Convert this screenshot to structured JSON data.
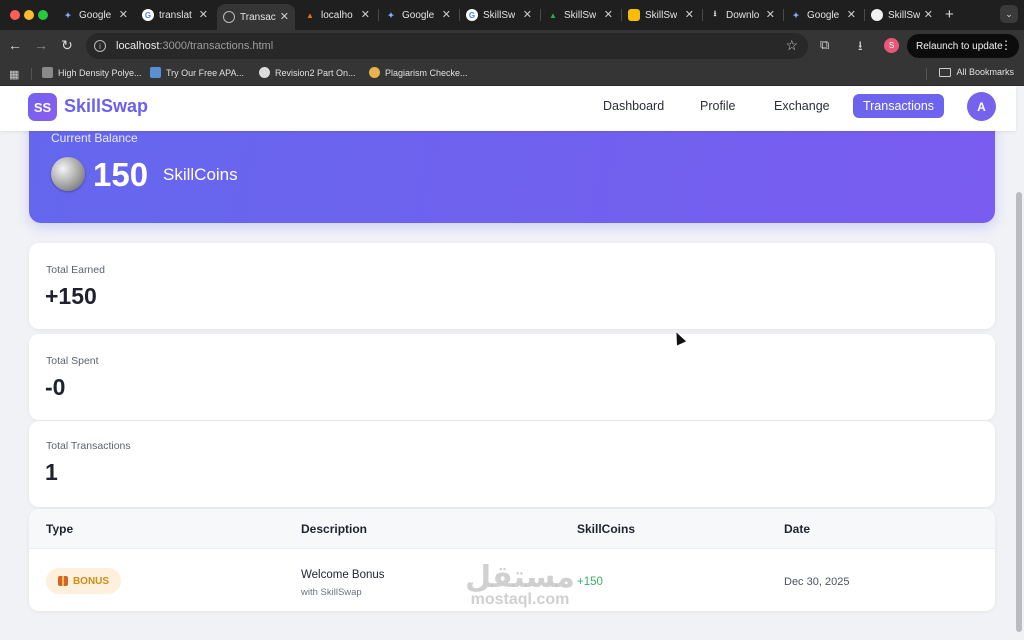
{
  "browser": {
    "tabs": [
      {
        "title": "Google",
        "icon": "gemini-icon",
        "color": "#8ab4f8"
      },
      {
        "title": "translat",
        "icon": "google-icon",
        "color": "#4285f4"
      },
      {
        "title": "Transac",
        "icon": "globe-icon",
        "color": "#9aa0a6",
        "active": true
      },
      {
        "title": "localho",
        "icon": "sails-icon",
        "color": "#e8731a"
      },
      {
        "title": "Google",
        "icon": "gemini-icon",
        "color": "#8ab4f8"
      },
      {
        "title": "SkillSw",
        "icon": "google-icon",
        "color": "#4285f4"
      },
      {
        "title": "SkillSw",
        "icon": "drive-icon",
        "color": "#34a853"
      },
      {
        "title": "SkillSw",
        "icon": "slides-icon",
        "color": "#fbbc04"
      },
      {
        "title": "Downlo",
        "icon": "download-icon",
        "color": "#e3e3e3"
      },
      {
        "title": "Google",
        "icon": "gemini-icon",
        "color": "#8ab4f8"
      },
      {
        "title": "SkillSw",
        "icon": "github-icon",
        "color": "#f0f0f0"
      }
    ],
    "url_host": "localhost",
    "url_path": ":3000/transactions.html",
    "relaunch_label": "Relaunch to update",
    "profile_initial": "S",
    "bookmarks": [
      {
        "label": "High Density Polye...",
        "icon": "bookmark-favicon",
        "color": "#8a8a8a"
      },
      {
        "label": "Try Our Free APA...",
        "icon": "bookmark-favicon",
        "color": "#5a8fd6"
      },
      {
        "label": "Revision2 Part On...",
        "icon": "bookmark-favicon",
        "color": "#dcdcdc"
      },
      {
        "label": "Plagiarism Checke...",
        "icon": "bookmark-favicon",
        "color": "#e6b34d"
      }
    ],
    "all_bookmarks_label": "All Bookmarks"
  },
  "app": {
    "logo_mark": "SS",
    "logo_text": "SkillSwap",
    "nav": {
      "dashboard": "Dashboard",
      "profile": "Profile",
      "exchange": "Exchange",
      "transactions": "Transactions"
    },
    "avatar_initial": "A"
  },
  "balance": {
    "label": "Current Balance",
    "amount": "150",
    "unit": "SkillCoins"
  },
  "stats": [
    {
      "label": "Total Earned",
      "value": "+150"
    },
    {
      "label": "Total Spent",
      "value": "-0"
    },
    {
      "label": "Total Transactions",
      "value": "1"
    }
  ],
  "table": {
    "headers": [
      "Type",
      "Description",
      "SkillCoins",
      "Date"
    ],
    "rows": [
      {
        "type": "BONUS",
        "description": "Welcome Bonus",
        "description_sub": "with SkillSwap",
        "coins": "+150",
        "date": "Dec 30, 2025"
      }
    ]
  },
  "watermark": {
    "arabic": "مستقل",
    "latin": "mostaql.com"
  },
  "colors": {
    "accent": "#6c63ee",
    "positive": "#3ab06a",
    "badge_bg": "#fdf1dd",
    "badge_text": "#d48a14"
  }
}
